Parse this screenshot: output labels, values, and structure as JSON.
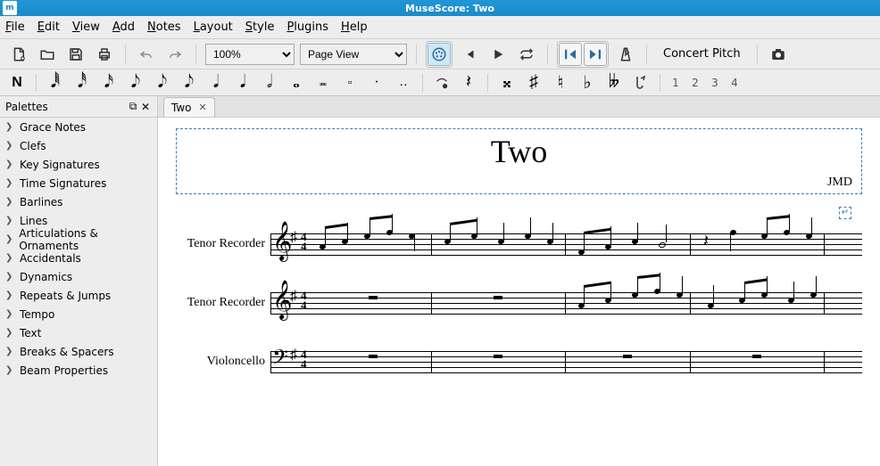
{
  "window": {
    "title": "MuseScore: Two",
    "logo": "m"
  },
  "menu": [
    "File",
    "Edit",
    "View",
    "Add",
    "Notes",
    "Layout",
    "Style",
    "Plugins",
    "Help"
  ],
  "toolbar": {
    "zoom": "100%",
    "view_mode": "Page View",
    "concert_pitch": "Concert Pitch",
    "voices": [
      "1",
      "2",
      "3",
      "4"
    ]
  },
  "palettes": {
    "title": "Palettes",
    "items": [
      "Grace Notes",
      "Clefs",
      "Key Signatures",
      "Time Signatures",
      "Barlines",
      "Lines",
      "Articulations & Ornaments",
      "Accidentals",
      "Dynamics",
      "Repeats & Jumps",
      "Tempo",
      "Text",
      "Breaks & Spacers",
      "Beam Properties"
    ]
  },
  "tab": {
    "label": "Two"
  },
  "score": {
    "title": "Two",
    "composer": "JMD",
    "staves": [
      {
        "label": "Tenor Recorder",
        "clef": "treble",
        "key": "sharp",
        "time": "4/4"
      },
      {
        "label": "Tenor Recorder",
        "clef": "treble",
        "key": "sharp",
        "time": "4/4"
      },
      {
        "label": "Violoncello",
        "clef": "bass",
        "key": "sharp",
        "time": "4/4"
      }
    ]
  }
}
